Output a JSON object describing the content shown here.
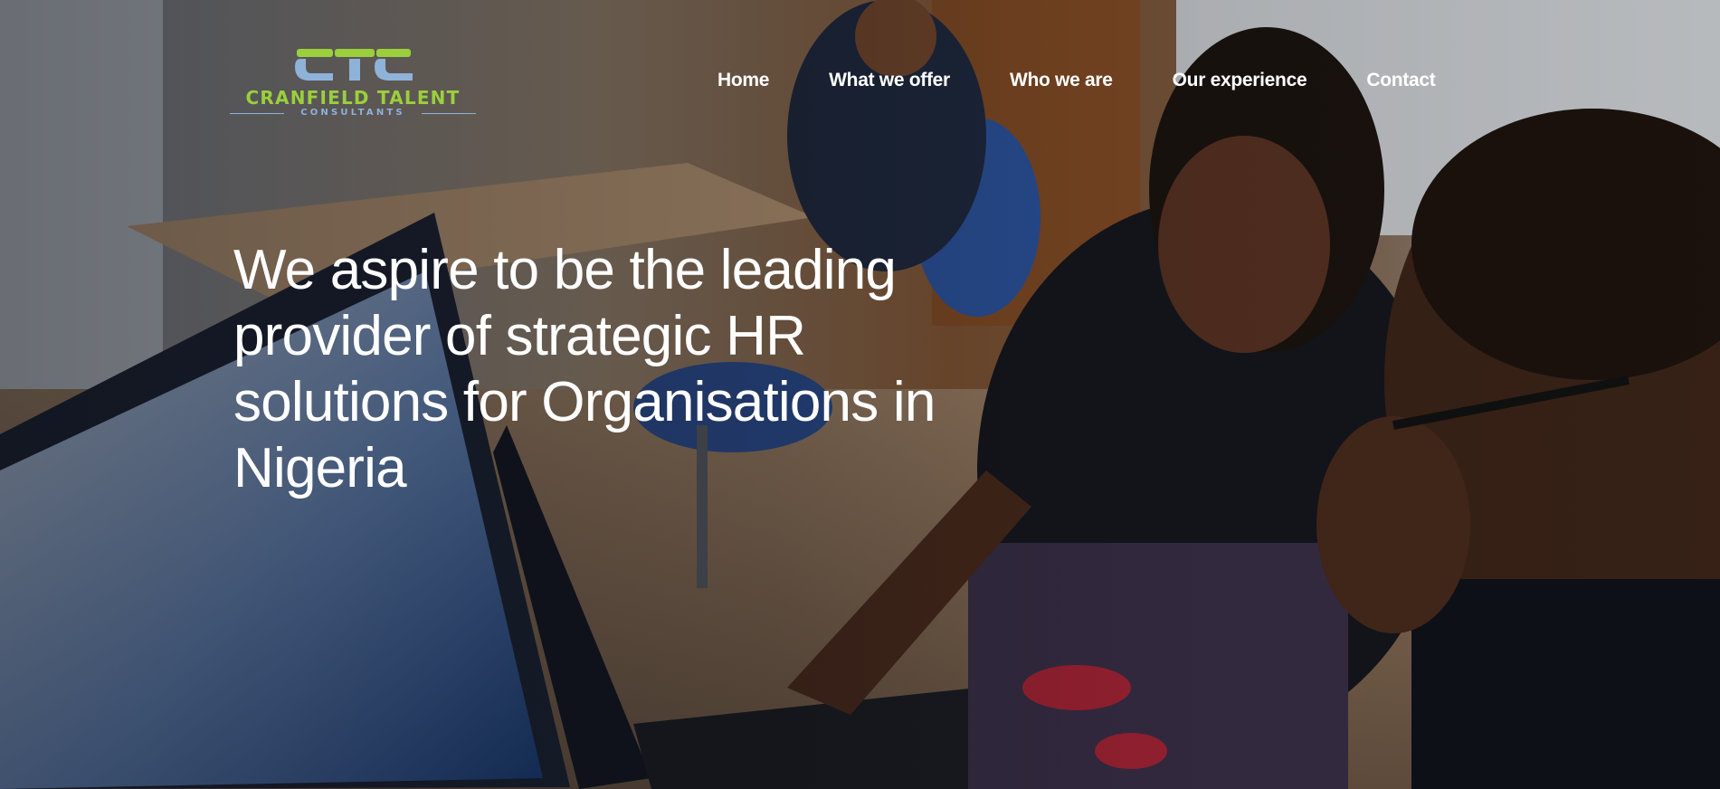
{
  "brand": {
    "monogram": "CTC",
    "company_name": "CRANFIELD TALENT",
    "tagline": "CONSULTANTS",
    "colors": {
      "green": "#9bcf3c",
      "blue": "#8fb2d8"
    }
  },
  "nav": {
    "items": [
      {
        "label": "Home"
      },
      {
        "label": "What we offer"
      },
      {
        "label": "Who we are"
      },
      {
        "label": "Our experience"
      },
      {
        "label": "Contact"
      }
    ]
  },
  "hero": {
    "heading_lines": [
      "We aspire to be the leading",
      "provider of strategic HR",
      "solutions for Organisations in",
      "Nigeria"
    ],
    "image": "photo-people-working-at-laptops"
  }
}
